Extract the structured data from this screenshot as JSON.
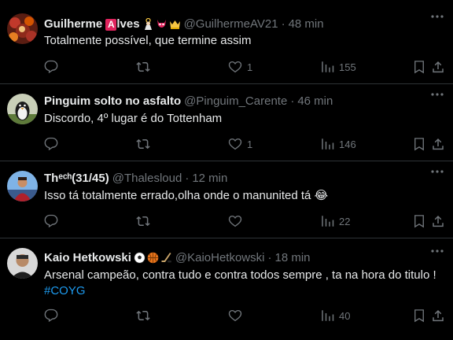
{
  "tweets": [
    {
      "name_pre": "Guilherme ",
      "name_letter": "A",
      "name_post": "lves",
      "handle": "@GuilhermeAV21",
      "separator": "·",
      "time": "48 min",
      "text": "Totalmente possível, que termine assim",
      "hashtag": "",
      "reply_count": "",
      "retweet_count": "",
      "like_count": "1",
      "view_count": "155"
    },
    {
      "name": "Pinguim solto no asfalto",
      "handle": "@Pinguim_Carente",
      "separator": "·",
      "time": "46 min",
      "text": "Discordo, 4º lugar é do Tottenham",
      "hashtag": "",
      "reply_count": "",
      "retweet_count": "",
      "like_count": "1",
      "view_count": "146"
    },
    {
      "name": "Thᵉᶜʰ(31/45)",
      "handle": "@Thalesloud",
      "separator": "·",
      "time": "12 min",
      "text": "Isso tá totalmente errado,olha onde o manunited tá",
      "emoji": "😂",
      "hashtag": "",
      "reply_count": "",
      "retweet_count": "",
      "like_count": "",
      "view_count": "22"
    },
    {
      "name": "Kaio Hetkowski",
      "handle": "@KaioHetkowski",
      "separator": "·",
      "time": "18 min",
      "text": "Arsenal campeão, contra tudo e contra todos sempre , ta na hora do titulo !",
      "hashtag": "#COYG",
      "reply_count": "",
      "retweet_count": "",
      "like_count": "",
      "view_count": "40"
    }
  ],
  "colors": {
    "background": "#000000",
    "text_primary": "#e7e9ea",
    "text_secondary": "#71767b",
    "divider": "#2f3336",
    "link": "#1d9bf0"
  },
  "icons": [
    "reply-icon",
    "retweet-icon",
    "like-icon",
    "views-icon",
    "bookmark-icon",
    "share-icon",
    "more-icon"
  ]
}
